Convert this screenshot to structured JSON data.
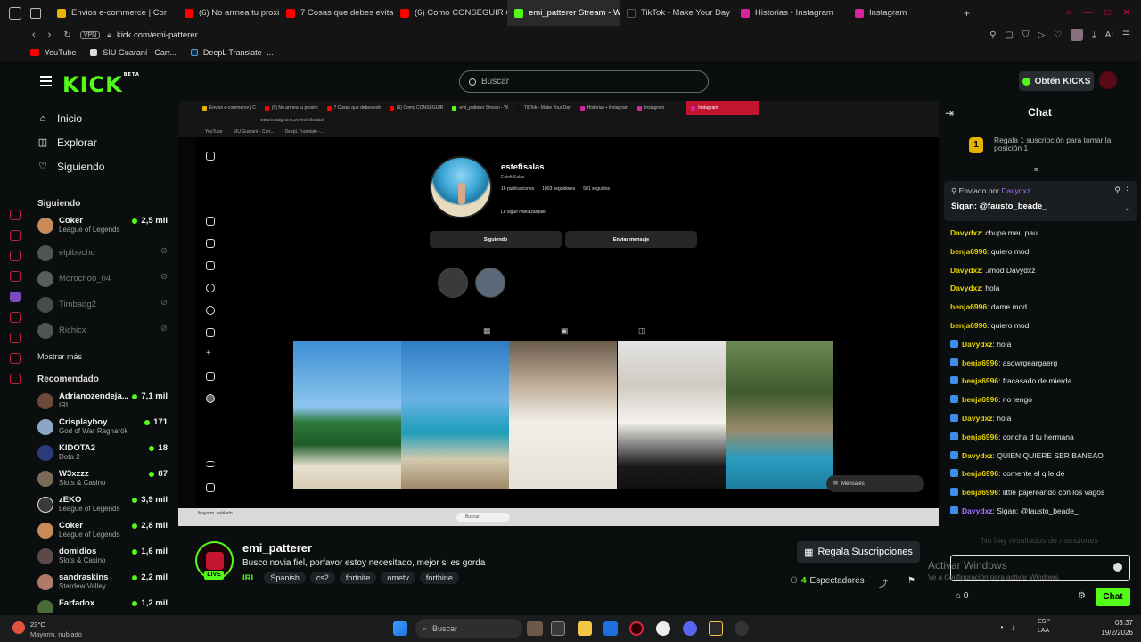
{
  "browser": {
    "tabs": [
      {
        "label": "Envios e-commerce | Cor",
        "color": "#e8b400"
      },
      {
        "label": "(6) No arrnea tu proximo c",
        "color": "#ff0000"
      },
      {
        "label": "7 Cosas que debes evitar",
        "color": "#ff0000"
      },
      {
        "label": "(6) Como CONSEGUIR CL",
        "color": "#ff0000"
      },
      {
        "label": "emi_patterer Stream - W",
        "color": "#53fc18"
      },
      {
        "label": "TikTok - Make Your Day",
        "color": "#111111"
      },
      {
        "label": "Historias • Instagram",
        "color": "#d6249f"
      },
      {
        "label": "Instagram",
        "color": "#d6249f"
      }
    ],
    "vpn_label": "VPN",
    "url": "kick.com/emi-patterer",
    "bookmarks": [
      "YouTube",
      "SIU Guaraní - Carr...",
      "DeepL Translate -..."
    ],
    "profile_label": "AI"
  },
  "kick": {
    "logo_text": "KICK",
    "logo_badge": "BETA",
    "search_placeholder": "Buscar",
    "get_kicks_label": "Obtén KICKS"
  },
  "sidebar": {
    "nav": [
      {
        "label": "Inicio",
        "icon": "home-icon"
      },
      {
        "label": "Explorar",
        "icon": "compass-icon"
      },
      {
        "label": "Siguiendo",
        "icon": "heart-icon"
      }
    ],
    "following_title": "Siguiendo",
    "following": [
      {
        "name": "Coker",
        "category": "League of Legends",
        "viewers": "2,5 mil",
        "live": true
      },
      {
        "name": "elpibecho",
        "live": false
      },
      {
        "name": "Morochoo_04",
        "live": false
      },
      {
        "name": "Timbadg2",
        "live": false
      },
      {
        "name": "Richicx",
        "live": false
      }
    ],
    "show_more": "Mostrar más",
    "recommended_title": "Recomendado",
    "recommended": [
      {
        "name": "Adrianozendeja...",
        "category": "IRL",
        "viewers": "7,1 mil"
      },
      {
        "name": "Crisplayboy",
        "category": "God of War Ragnarök",
        "viewers": "171"
      },
      {
        "name": "KIDOTA2",
        "category": "Dota 2",
        "viewers": "18"
      },
      {
        "name": "W3xzzz",
        "category": "Slots & Casino",
        "viewers": "87"
      },
      {
        "name": "zEKO",
        "category": "League of Legends",
        "viewers": "3,9 mil"
      },
      {
        "name": "Coker",
        "category": "League of Legends",
        "viewers": "2,8 mil"
      },
      {
        "name": "domidios",
        "category": "Slots & Casino",
        "viewers": "1,6 mil"
      },
      {
        "name": "sandraskins",
        "category": "Stardew Valley",
        "viewers": "2,2 mil"
      },
      {
        "name": "Farfadox",
        "category": "",
        "viewers": "1,2 mil"
      }
    ]
  },
  "stream_screen": {
    "inner_tabs": [
      "Envios e-commerce | C",
      "(6) No arrnea tu proxim",
      "7 Cosas que debes evit",
      "(6) Como CONSEGUIR",
      "emi_patterer Stream - W",
      "TikTok - Make Your Day",
      "Historias • Instagram",
      "Instagram",
      "Instagram"
    ],
    "inner_url": "www.instagram.com/estefisalas/",
    "inner_bookmarks": [
      "YouTube",
      "SIU Guaraní - Carr...",
      "DeepL Translate -..."
    ],
    "profile": {
      "username": "estefisalas",
      "full_name": "Estefi Salas",
      "posts": "16 publicaciones",
      "followers": "1003 seguidores",
      "following": "581 seguidos",
      "followed_by": "Le sigue ivanlazargallo",
      "btn_following": "Siguiendo",
      "btn_message": "Enviar mensaje"
    },
    "toast_label": "Mensajes",
    "inner_search": "Buscar",
    "inner_weather": "Mayorm. nublado"
  },
  "stream_info": {
    "streamer": "emi_patterer",
    "live_label": "LIVE",
    "title": "Busco novia fiel, porfavor estoy necesitado, mejor si es gorda",
    "category": "IRL",
    "tags": [
      "Spanish",
      "cs2",
      "fortnite",
      "ometv",
      "forthine"
    ],
    "subs_button": "Regala Suscripciones",
    "viewers_count": "4",
    "viewers_label": "Espectadores"
  },
  "chat": {
    "title": "Chat",
    "goal_text": "Regala 1 suscripción para tomar la posición 1",
    "goal_rank": "1",
    "pinned_by_label": "Enviado por",
    "pinned_by_user": "Davydxz",
    "pinned_message": "Sigan: @fausto_beade_",
    "messages": [
      {
        "user": "Davydxz",
        "text": "chupa meu pau",
        "color": "#e6d400",
        "badge": false
      },
      {
        "user": "benja6996",
        "text": "quiero mod",
        "color": "#e6d400",
        "badge": false
      },
      {
        "user": "Davydxz",
        "text": "./mod Davydxz",
        "color": "#e6d400",
        "badge": false
      },
      {
        "user": "Davydxz",
        "text": "hola",
        "color": "#e6d400",
        "badge": false
      },
      {
        "user": "benja6996",
        "text": "dame mod",
        "color": "#e6d400",
        "badge": false
      },
      {
        "user": "benja6996",
        "text": "quiero mod",
        "color": "#e6d400",
        "badge": false
      },
      {
        "user": "Davydxz",
        "text": "hola",
        "color": "#e6d400",
        "badge": true
      },
      {
        "user": "benja6996",
        "text": "asdwrgeargaerg",
        "color": "#e6d400",
        "badge": true
      },
      {
        "user": "benja6996",
        "text": "fracasado de mierda",
        "color": "#e6d400",
        "badge": true
      },
      {
        "user": "benja6996",
        "text": "no tengo",
        "color": "#e6d400",
        "badge": true
      },
      {
        "user": "Davydxz",
        "text": "hola",
        "color": "#e6d400",
        "badge": true
      },
      {
        "user": "benja6996",
        "text": "concha d tu hermana",
        "color": "#e6d400",
        "badge": true
      },
      {
        "user": "Davydxz",
        "text": "QUIEN QUIERE SER BANEAO",
        "color": "#e6d400",
        "badge": true
      },
      {
        "user": "benja6996",
        "text": "comente el q le de",
        "color": "#e6d400",
        "badge": true
      },
      {
        "user": "benja6996",
        "text": "little pajereando con los vagos",
        "color": "#e6d400",
        "badge": true
      },
      {
        "user": "Davydxz",
        "text": "Sigan: @fausto_beade_",
        "color": "#a874ff",
        "badge": true
      }
    ],
    "no_results": "No hay resultados de menciones",
    "activate_windows": "Activar Windows",
    "activate_windows_sub": "Ve a Configuración para activar Windows.",
    "points": "0",
    "send_label": "Chat"
  },
  "taskbar": {
    "temp": "23°C",
    "weather": "Mayorm. nublado",
    "search": "Buscar",
    "lang1": "ESP",
    "lang2": "LAA",
    "time": "03:37",
    "date": "19/2/2026"
  }
}
